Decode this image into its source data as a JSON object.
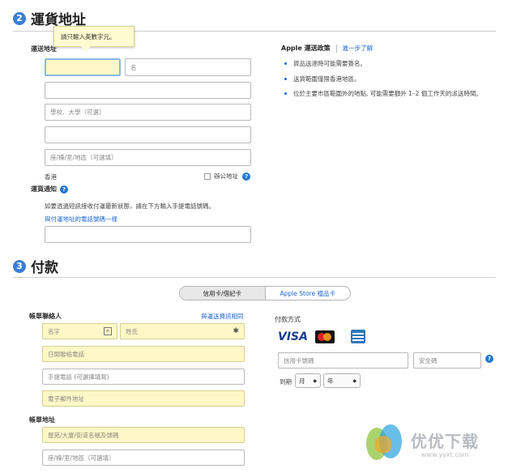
{
  "shipping": {
    "step_number": "2",
    "title": "運貨地址",
    "address_label": "運送地址",
    "tooltip": "請只輸入英數字元。",
    "fields": {
      "first_name_placeholder": "",
      "last_name_placeholder": "名",
      "school_placeholder": "學校、大學（可選）",
      "building_placeholder": "座/棟/室/地區（可選填）"
    },
    "region": "香港",
    "business_address_label": "辦公地址",
    "notify_label": "運貨通知",
    "notify_text": "如要透過短訊接收付運最新狀態，請在下方輸入手提電話號碼。",
    "same_phone_link": "與付運地址的電話號碼一樣",
    "policy": {
      "title": "Apple 運送政策",
      "link": "進一步了解",
      "bullets": [
        "貨品送達時可能需要簽名。",
        "送貨範圍僅限香港地區。",
        "位於主要市區範圍外的地點, 可能需要額外 1–2 個工作天的派送時間。"
      ]
    }
  },
  "payment": {
    "step_number": "3",
    "title": "付款",
    "tabs": [
      "信用卡/借記卡",
      "Apple Store 禮品卡"
    ],
    "contact_label": "帳單聯絡人",
    "same_as_shipping_link": "與運送資訊相同",
    "fields": {
      "first_name_placeholder": "名字",
      "last_name_placeholder": "姓氏",
      "day_phone_placeholder": "日間聯絡電話",
      "mobile_placeholder": "手提電話 (可選擇填寫)",
      "email_placeholder": "電子郵件地址",
      "street_placeholder": "屋苑/大廈/街道名稱及號碼",
      "building_placeholder": "座/棟/室/地區（可選填）"
    },
    "billing_address_label": "帳單地址",
    "method_label": "付款方式",
    "cards": [
      "VISA",
      "MasterCard",
      "AMEX"
    ],
    "card_number_placeholder": "信用卡號碼",
    "security_code_placeholder": "安全碼",
    "expiry_label": "到期",
    "month_label": "月",
    "year_label": "年"
  },
  "watermark": {
    "brand": "优优下载",
    "url": "www.yyxt.com"
  },
  "colors": {
    "accent": "#3a7fd5",
    "link": "#1a66cc",
    "field_highlight": "#fff8c6"
  }
}
